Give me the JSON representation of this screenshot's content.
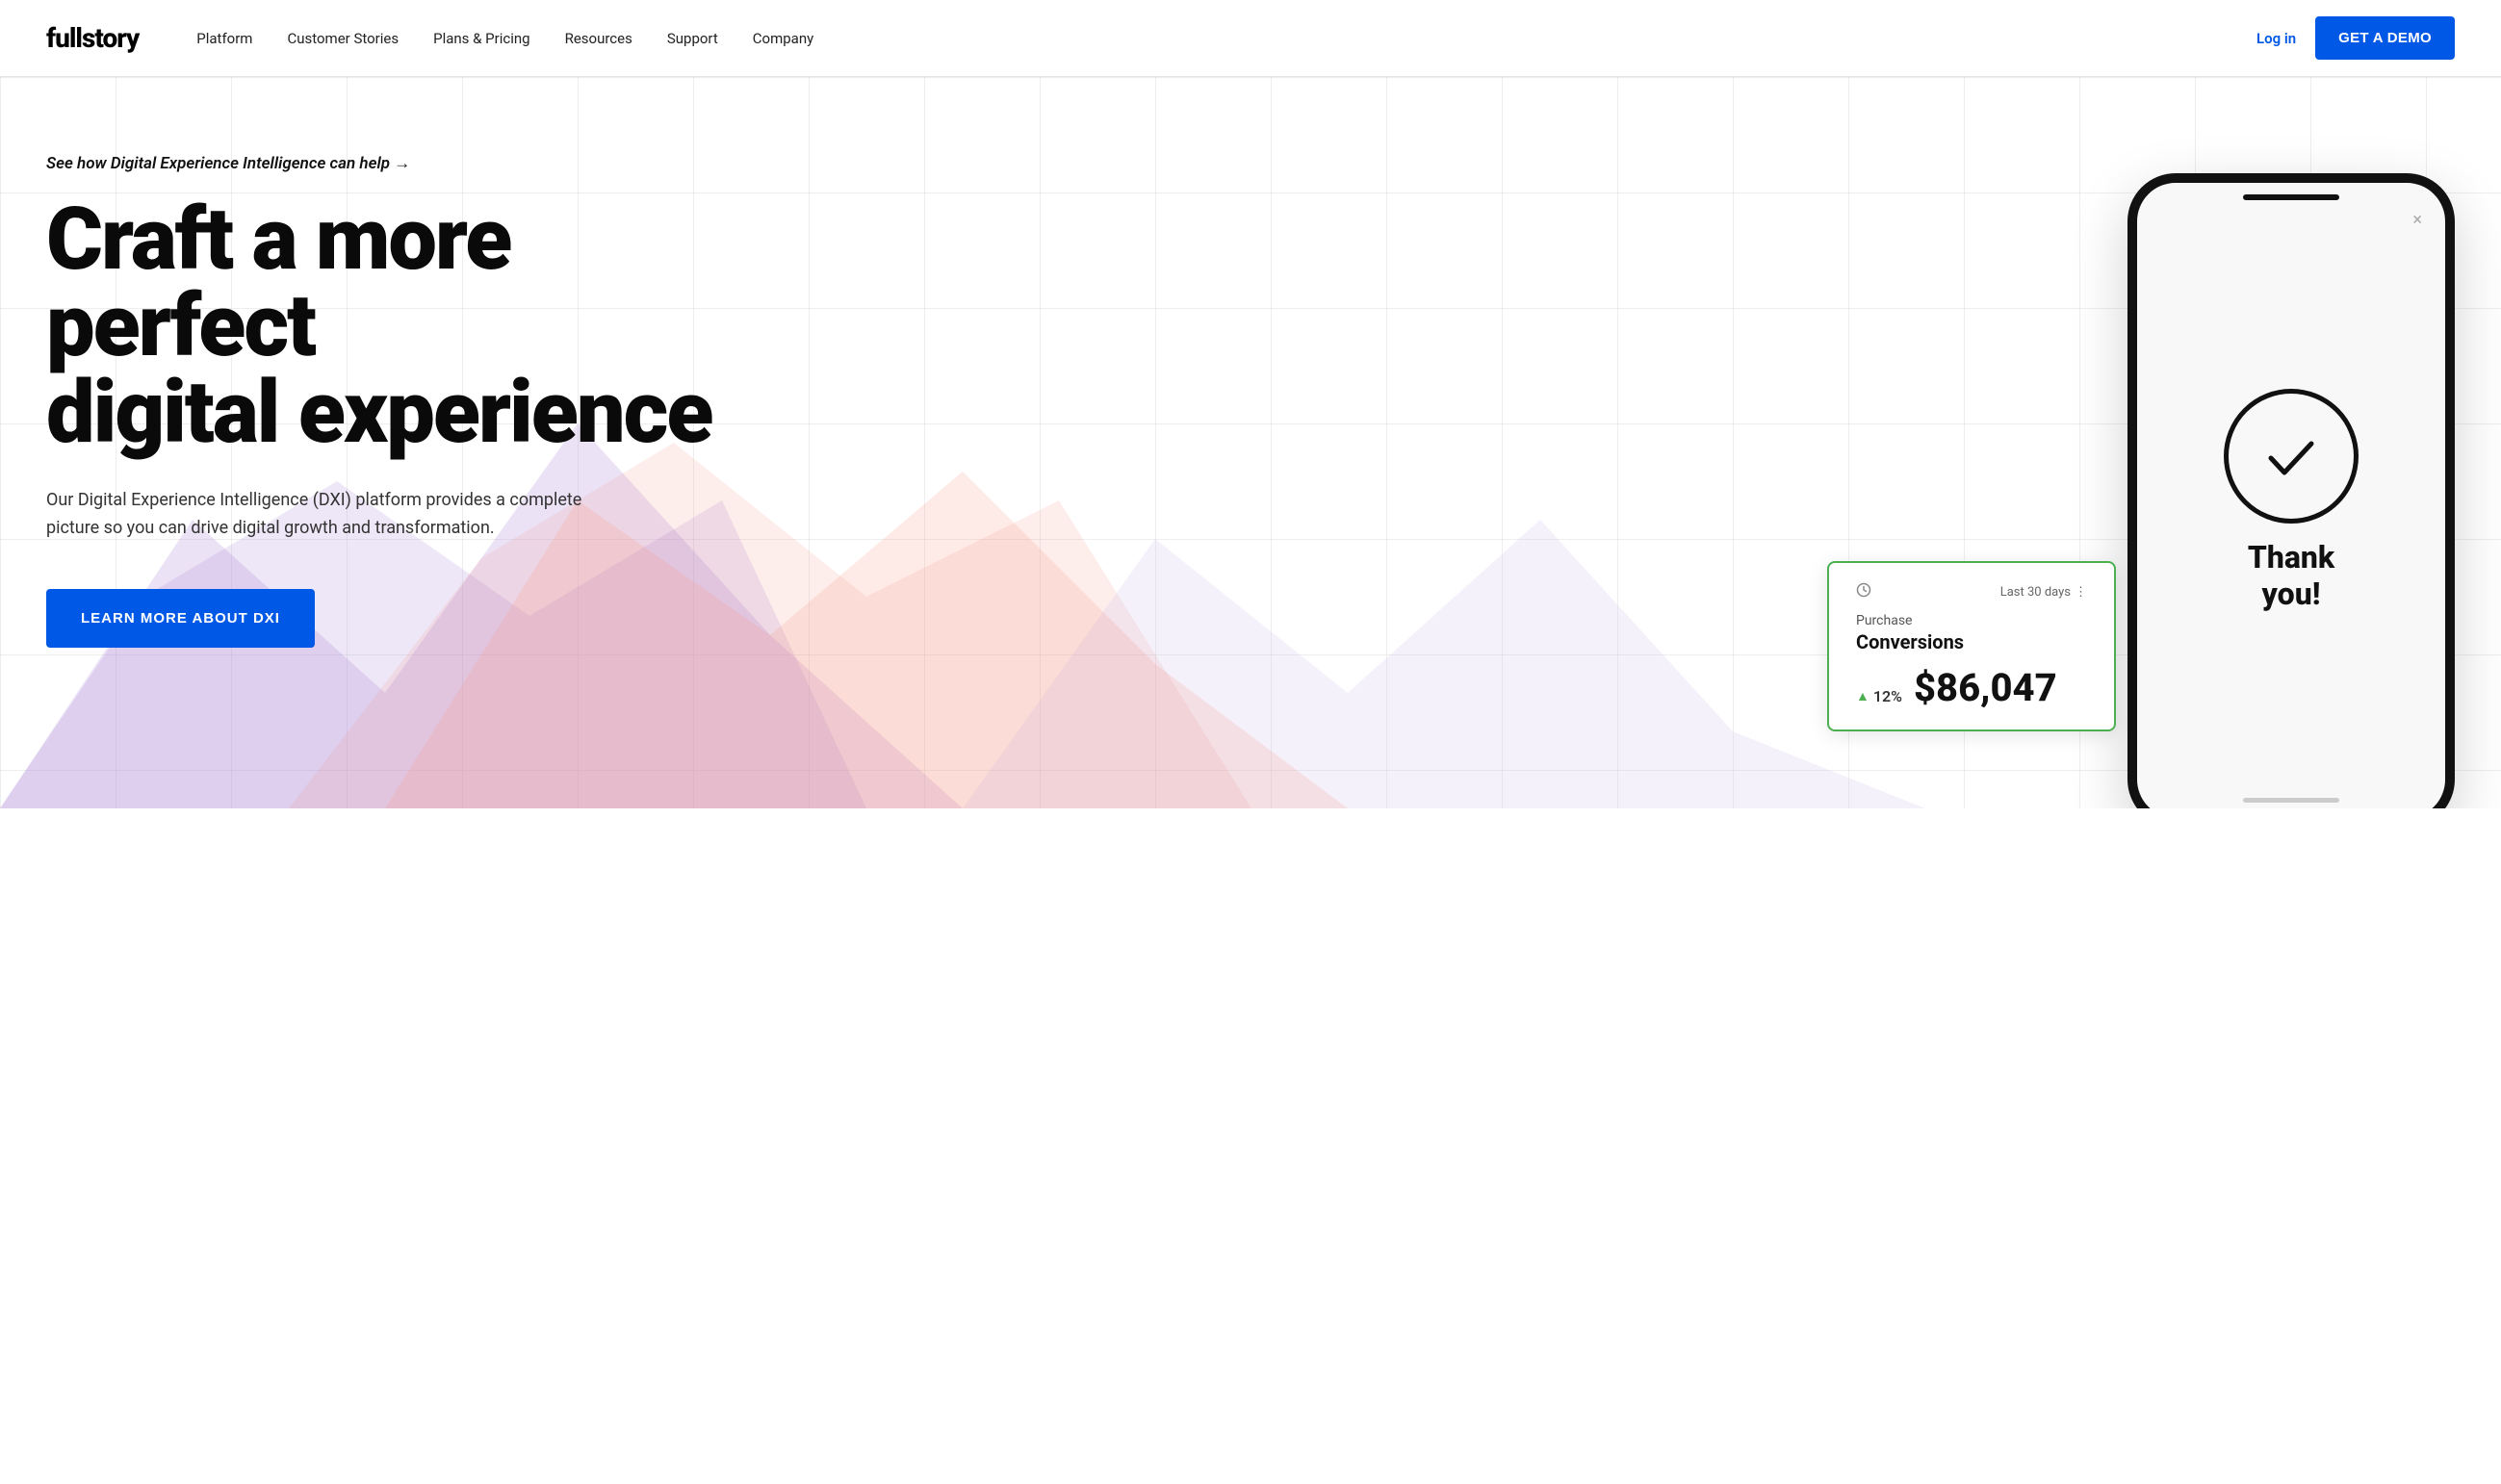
{
  "brand": {
    "logo": "fullstory"
  },
  "nav": {
    "links": [
      {
        "label": "Platform",
        "id": "platform"
      },
      {
        "label": "Customer Stories",
        "id": "customer-stories"
      },
      {
        "label": "Plans & Pricing",
        "id": "plans-pricing"
      },
      {
        "label": "Resources",
        "id": "resources"
      },
      {
        "label": "Support",
        "id": "support"
      },
      {
        "label": "Company",
        "id": "company"
      }
    ],
    "login_label": "Log in",
    "demo_label": "GET A DEMO"
  },
  "hero": {
    "eyebrow": "See how Digital Experience Intelligence can help →",
    "title_line1": "Craft a more perfect",
    "title_line2": "digital experience",
    "subtitle": "Our Digital Experience Intelligence (DXI) platform provides a complete picture so you can drive digital growth and transformation.",
    "cta_label": "LEARN MORE ABOUT DXI"
  },
  "phone": {
    "close_icon": "×",
    "check_icon": "✓",
    "thankyou_line1": "Thank",
    "thankyou_line2": "you!"
  },
  "conversion_card": {
    "clock_icon": "🕐",
    "period_label": "Last 30 days",
    "more_icon": "⋮",
    "label": "Purchase",
    "title": "Conversions",
    "pct_arrow": "▲",
    "pct": "12%",
    "value": "$86,047"
  },
  "colors": {
    "accent": "#0058e6",
    "green": "#4caf50",
    "text_dark": "#0a0a0a",
    "text_mid": "#333"
  }
}
